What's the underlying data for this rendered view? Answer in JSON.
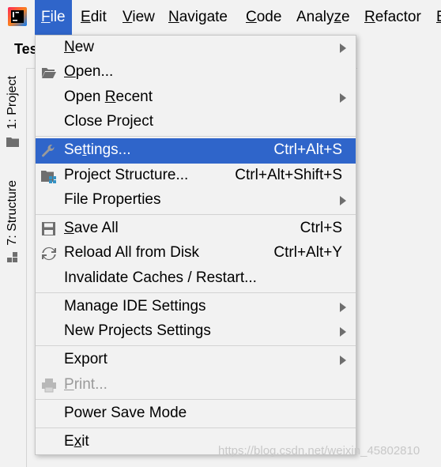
{
  "menubar": {
    "items": [
      {
        "label": "File",
        "mnemonic": "F",
        "rest": "ile"
      },
      {
        "label": "Edit",
        "mnemonic": "E",
        "rest": "dit"
      },
      {
        "label": "View",
        "mnemonic": "V",
        "rest": "iew"
      },
      {
        "label": "Navigate",
        "mnemonic": "N",
        "rest": "avigate"
      },
      {
        "label": "Code",
        "mnemonic": "C",
        "rest": "ode"
      },
      {
        "label": "Analyze",
        "pre": "Analy",
        "mnemonic": "z",
        "rest": "e"
      },
      {
        "label": "Refactor",
        "mnemonic": "R",
        "rest": "efactor"
      },
      {
        "label": "B",
        "mnemonic": "B",
        "rest": ""
      }
    ],
    "active": "File"
  },
  "editor": {
    "tab_label": "Tes"
  },
  "sidebar": {
    "project_tab": "1: Project",
    "structure_tab": "7: Structure"
  },
  "file_menu": {
    "new": {
      "label": "New",
      "mnemonic": "N",
      "rest": "ew"
    },
    "open": {
      "label": "Open...",
      "mnemonic": "O",
      "rest": "pen..."
    },
    "open_recent": {
      "pre": "Open ",
      "mnemonic": "R",
      "rest": "ecent"
    },
    "close_project": {
      "label": "Close Project"
    },
    "settings": {
      "pre": "Se",
      "mnemonic": "t",
      "rest": "tings...",
      "shortcut": "Ctrl+Alt+S"
    },
    "project_structure": {
      "label": "Project Structure...",
      "shortcut": "Ctrl+Alt+Shift+S"
    },
    "file_properties": {
      "label": "File Properties"
    },
    "save_all": {
      "mnemonic": "S",
      "rest": "ave All",
      "shortcut": "Ctrl+S"
    },
    "reload": {
      "label": "Reload All from Disk",
      "shortcut": "Ctrl+Alt+Y"
    },
    "invalidate": {
      "label": "Invalidate Caches / Restart..."
    },
    "manage_ide": {
      "label": "Manage IDE Settings"
    },
    "new_projects_settings": {
      "label": "New Projects Settings"
    },
    "export": {
      "label": "Export"
    },
    "print": {
      "mnemonic": "P",
      "rest": "rint..."
    },
    "power_save": {
      "label": "Power Save Mode"
    },
    "exit": {
      "pre": "E",
      "mnemonic": "x",
      "rest": "it"
    }
  },
  "watermark": "https://blog.csdn.net/weixin_45802810",
  "colors": {
    "selection": "#2f65ca",
    "background": "#f2f2f2"
  }
}
